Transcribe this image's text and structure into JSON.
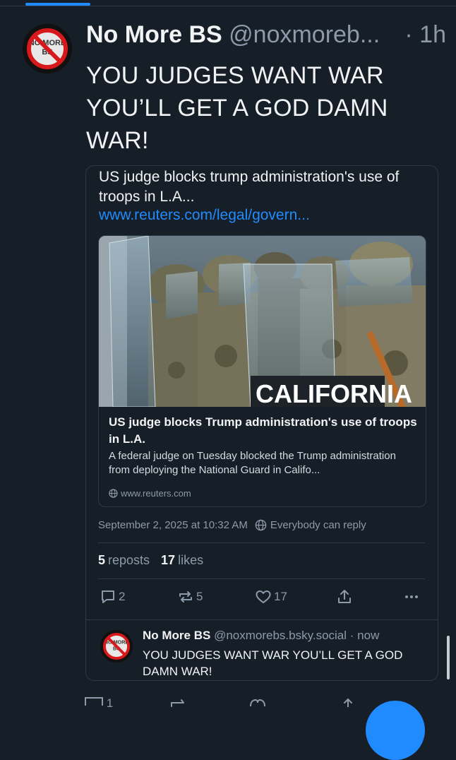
{
  "post": {
    "author_name": "No More BS",
    "handle": "@noxmoreb...",
    "time": "· 1h",
    "text": "YOU JUDGES WANT WAR YOU’LL GET A GOD DAMN WAR!",
    "avatar_label": "NO MORE BS"
  },
  "embed": {
    "title": "US judge blocks trump administration's use of troops in L.A...",
    "url": "www.reuters.com/legal/govern...",
    "link_card": {
      "image_text": "CALIFORNIA",
      "title": "US judge blocks Trump administration's use of troops in L.A.",
      "description": "A federal judge on Tuesday blocked the Trump administration from deploying the National Guard in Califo...",
      "domain": "www.reuters.com"
    },
    "meta": {
      "date": "September 2, 2025 at 10:32 AM",
      "reply_setting": "Everybody can reply"
    },
    "stats": {
      "reposts_count": "5",
      "reposts_label": "reposts",
      "likes_count": "17",
      "likes_label": "likes"
    },
    "actions": {
      "replies": "2",
      "reposts": "5",
      "likes": "17"
    },
    "reply": {
      "author_name": "No More BS",
      "handle": "@noxmorebs.bsky.social",
      "time": "· now",
      "text": "YOU JUDGES WANT WAR YOU’LL GET A GOD DAMN WAR!"
    }
  },
  "next_post_actions": {
    "replies": "1"
  },
  "colors": {
    "background": "#161e27",
    "accent": "#208bfe",
    "muted_text": "#8d9aa9",
    "border": "#2e3a47"
  }
}
